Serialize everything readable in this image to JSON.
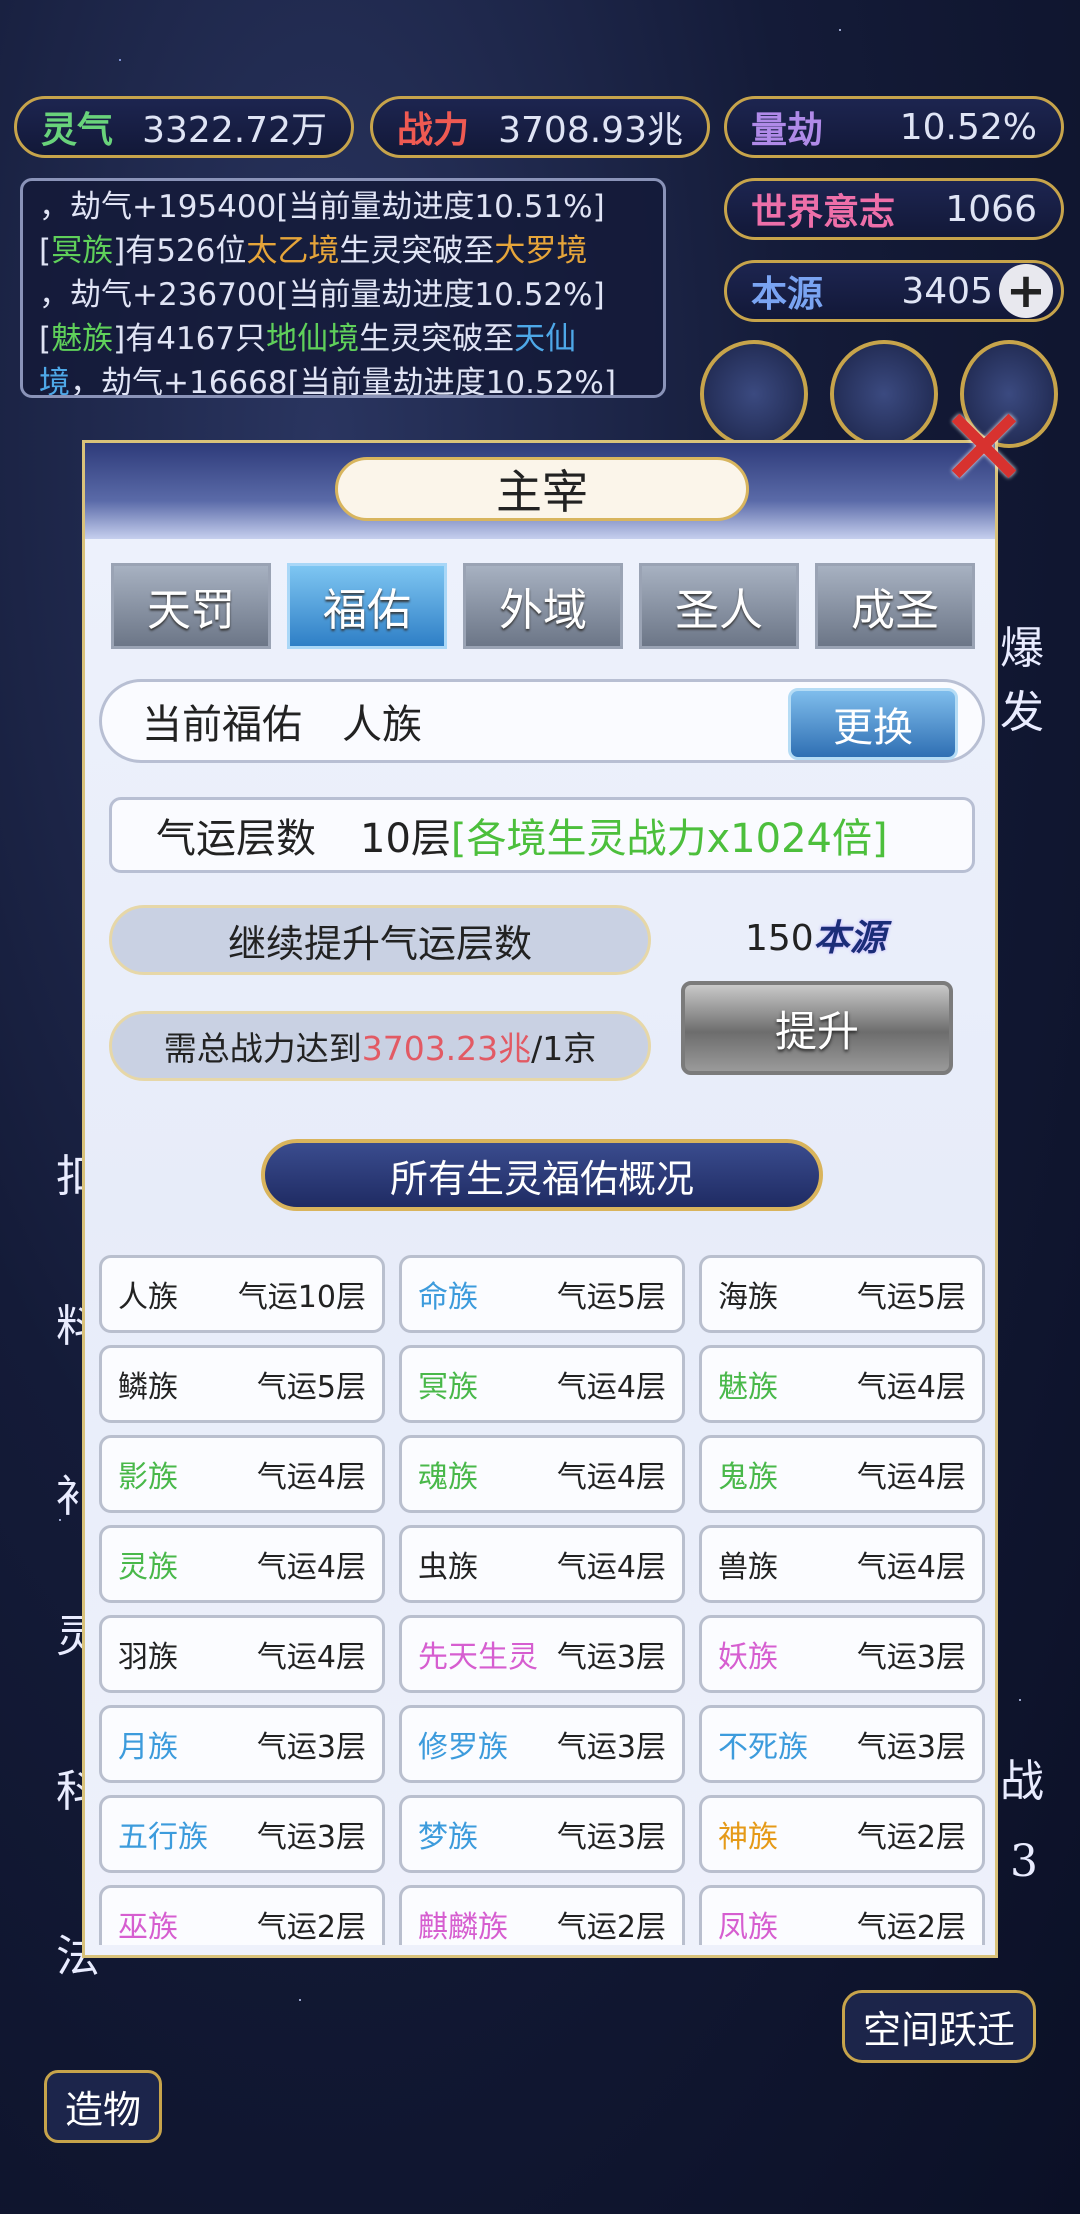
{
  "hud": {
    "lingqi": {
      "label": "灵气",
      "value": "3322.72万"
    },
    "zhanli": {
      "label": "战力",
      "value": "3708.93兆"
    },
    "liangjie": {
      "label": "量劫",
      "value": "10.52%"
    },
    "shijie": {
      "label": "世界意志",
      "value": "1066"
    },
    "benyuan": {
      "label": "本源",
      "value": "3405",
      "plus": "+"
    }
  },
  "log": {
    "line1": "，劫气+195400[当前量劫进度10.51%]",
    "l2_a": "[",
    "l2_race": "冥族",
    "l2_b": "]有526位",
    "l2_realm": "太乙境",
    "l2_c": "生灵突破至",
    "l2_target": "大罗境",
    "line3": "，劫气+236700[当前量劫进度10.52%]",
    "l4_a": "[",
    "l4_race": "魅族",
    "l4_b": "]有4167只",
    "l4_realm": "地仙境",
    "l4_c": "生灵突破至",
    "l4_target": "天仙",
    "l5_target": "境",
    "l5_rest": "，劫气+16668[当前量劫进度10.52%]"
  },
  "side": {
    "left_chars": [
      "扣",
      "料",
      "补",
      "灵",
      "科",
      "法"
    ],
    "right_burst": "爆发",
    "right_battle": "战",
    "right_num": "3",
    "space_jump": "空间跃迁",
    "zaowu": "造物"
  },
  "panel": {
    "title": "主宰",
    "close": "✕",
    "tabs": [
      "天罚",
      "福佑",
      "外域",
      "圣人",
      "成圣"
    ],
    "active_tab": 1,
    "current_label": "当前福佑",
    "current_value": "人族",
    "swap_label": "更换",
    "fortune_label": "气运层数",
    "fortune_value": "10层",
    "fortune_bonus": "[各境生灵战力x1024倍]",
    "upgrade_label": "继续提升气运层数",
    "cost_value": "150",
    "cost_unit": "本源",
    "req_prefix": "需总战力达到",
    "req_value": "3703.23兆",
    "req_suffix": "/1京",
    "raise_label": "提升",
    "overview_title": "所有生灵福佑概况"
  },
  "races": [
    {
      "name": "人族",
      "level": "气运10层",
      "color": "dark"
    },
    {
      "name": "命族",
      "level": "气运5层",
      "color": "blue"
    },
    {
      "name": "海族",
      "level": "气运5层",
      "color": "dark"
    },
    {
      "name": "鳞族",
      "level": "气运5层",
      "color": "dark"
    },
    {
      "name": "冥族",
      "level": "气运4层",
      "color": "green"
    },
    {
      "name": "魅族",
      "level": "气运4层",
      "color": "green"
    },
    {
      "name": "影族",
      "level": "气运4层",
      "color": "green"
    },
    {
      "name": "魂族",
      "level": "气运4层",
      "color": "green"
    },
    {
      "name": "鬼族",
      "level": "气运4层",
      "color": "green"
    },
    {
      "name": "灵族",
      "level": "气运4层",
      "color": "green"
    },
    {
      "name": "虫族",
      "level": "气运4层",
      "color": "dark"
    },
    {
      "name": "兽族",
      "level": "气运4层",
      "color": "dark"
    },
    {
      "name": "羽族",
      "level": "气运4层",
      "color": "dark"
    },
    {
      "name": "先天生灵",
      "level": "气运3层",
      "color": "pink"
    },
    {
      "name": "妖族",
      "level": "气运3层",
      "color": "pink"
    },
    {
      "name": "月族",
      "level": "气运3层",
      "color": "blue"
    },
    {
      "name": "修罗族",
      "level": "气运3层",
      "color": "blue"
    },
    {
      "name": "不死族",
      "level": "气运3层",
      "color": "blue"
    },
    {
      "name": "五行族",
      "level": "气运3层",
      "color": "blue"
    },
    {
      "name": "梦族",
      "level": "气运3层",
      "color": "blue"
    },
    {
      "name": "神族",
      "level": "气运2层",
      "color": "orange"
    },
    {
      "name": "巫族",
      "level": "气运2层",
      "color": "pink"
    },
    {
      "name": "麒麟族",
      "level": "气运2层",
      "color": "pink"
    },
    {
      "name": "凤族",
      "level": "气运2层",
      "color": "pink"
    }
  ]
}
